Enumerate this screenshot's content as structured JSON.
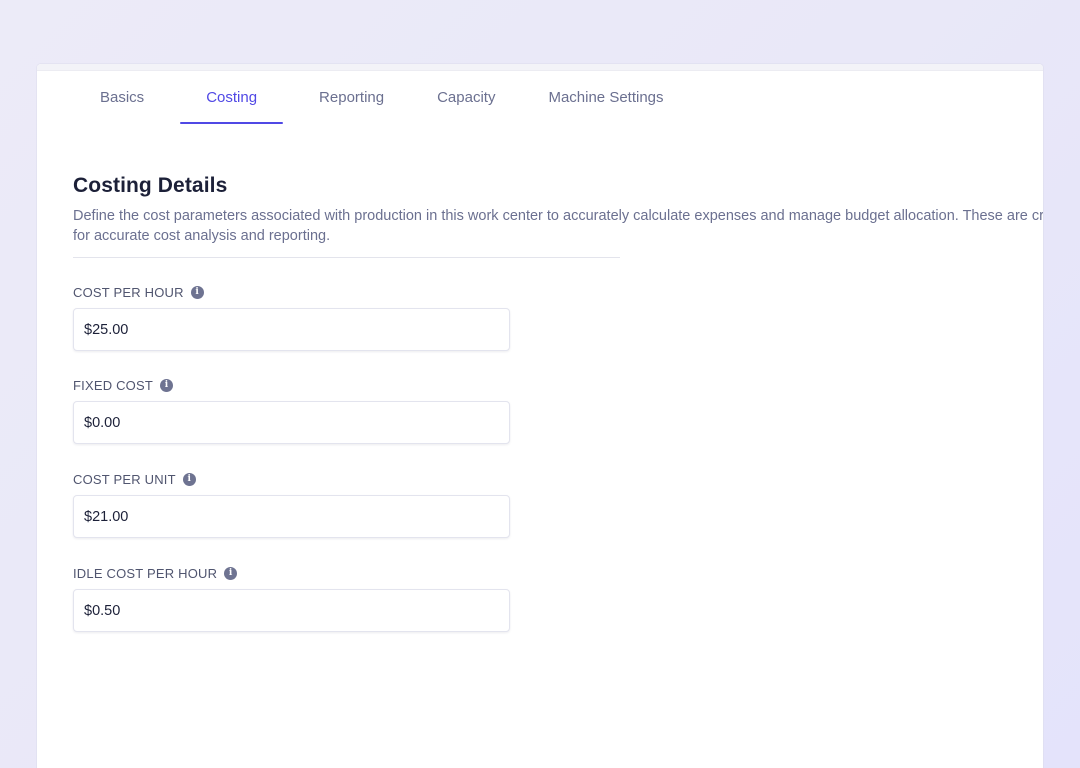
{
  "tabs": [
    {
      "label": "Basics",
      "active": false
    },
    {
      "label": "Costing",
      "active": true
    },
    {
      "label": "Reporting",
      "active": false
    },
    {
      "label": "Capacity",
      "active": false
    },
    {
      "label": "Machine Settings",
      "active": false
    }
  ],
  "section": {
    "title": "Costing Details",
    "description": "Define the cost parameters associated with production in this work center to accurately calculate expenses and manage budget allocation. These are critical for accurate cost analysis and reporting."
  },
  "fields": [
    {
      "label": "COST PER HOUR",
      "value": "$25.00",
      "icon": "info-icon"
    },
    {
      "label": "FIXED COST",
      "value": "$0.00",
      "icon": "info-icon"
    },
    {
      "label": "COST PER UNIT",
      "value": "$21.00",
      "icon": "info-icon"
    },
    {
      "label": "IDLE COST PER HOUR",
      "value": "$0.50",
      "icon": "info-icon"
    }
  ],
  "colors": {
    "accent": "#5048e5",
    "text_primary": "#1c2038",
    "text_secondary": "#6b7090",
    "background": "#e9e8f8"
  }
}
